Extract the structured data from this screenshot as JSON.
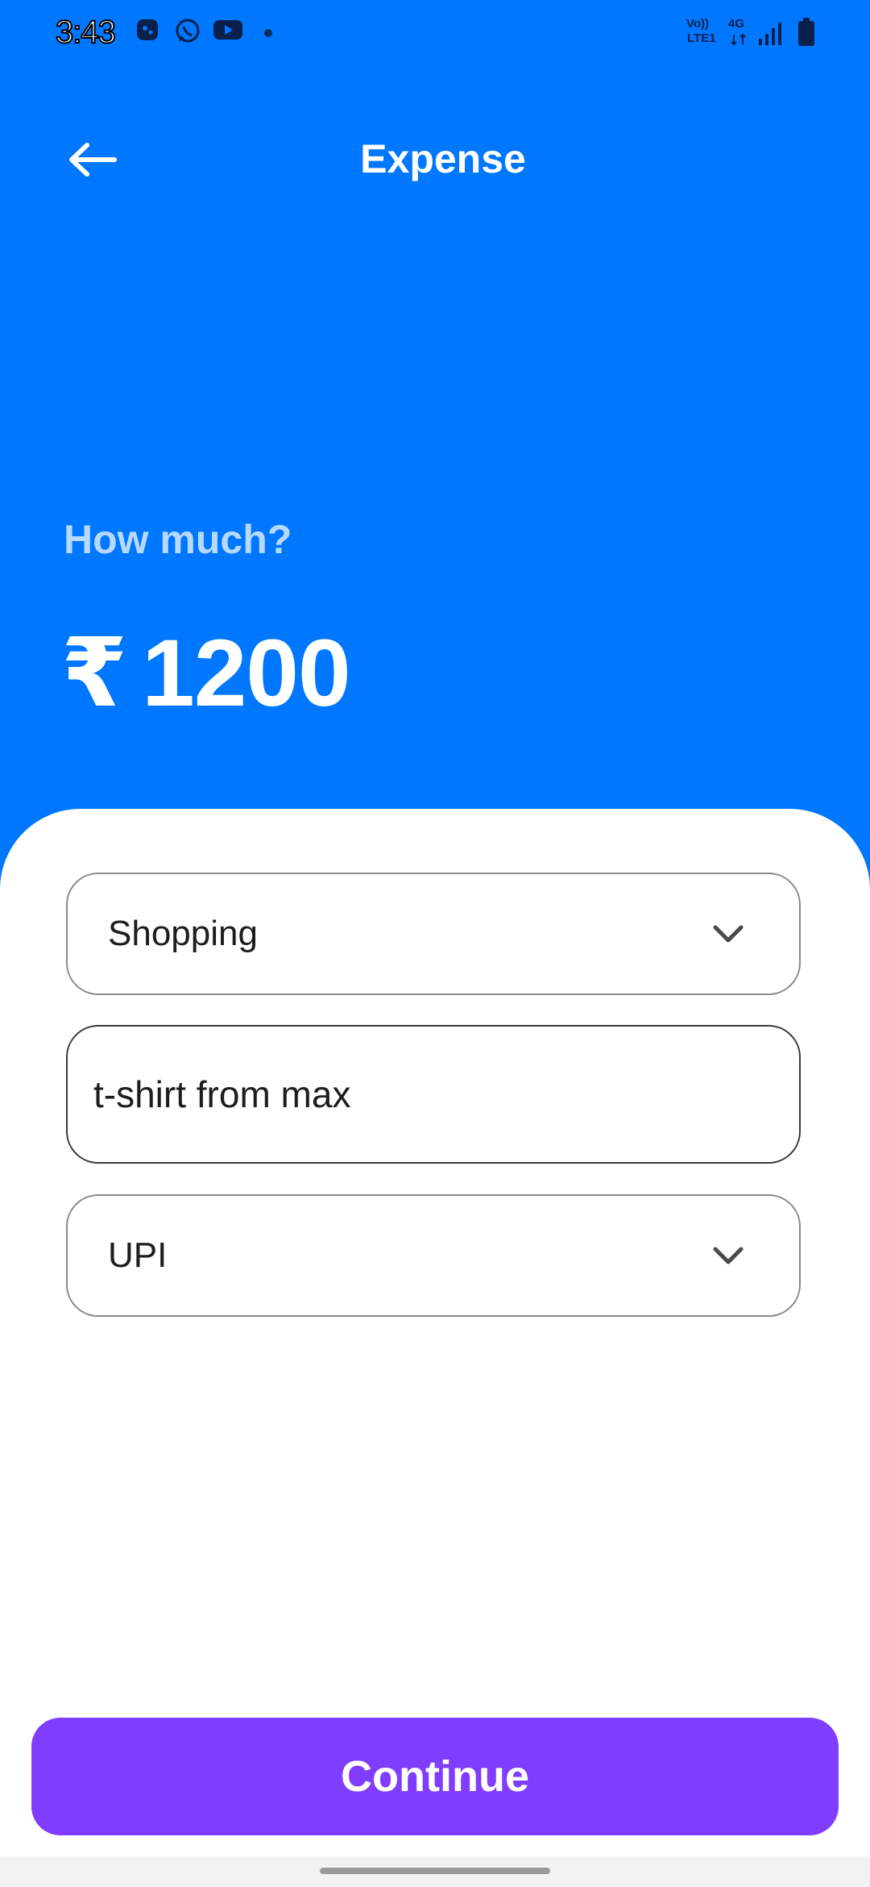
{
  "status_bar": {
    "time": "3:43",
    "network_volte": "Vo))",
    "network_lte": "LTE1",
    "network_4g": "4G",
    "icons": [
      "game-icon",
      "whatsapp-icon",
      "youtube-icon",
      "notification-dot",
      "signal-icon",
      "battery-icon"
    ]
  },
  "header": {
    "back_icon": "arrow-left-icon",
    "title": "Expense"
  },
  "amount_section": {
    "prompt": "How much?",
    "currency_symbol": "₹",
    "amount": "1200"
  },
  "form": {
    "category": {
      "selected": "Shopping",
      "icon": "chevron-down-icon"
    },
    "description": {
      "value": "t-shirt from max"
    },
    "payment_method": {
      "selected": "UPI",
      "icon": "chevron-down-icon"
    }
  },
  "actions": {
    "continue_label": "Continue"
  },
  "colors": {
    "header_bg": "#0077FF",
    "button_bg": "#7F3DFF",
    "sheet_bg": "#FFFFFF"
  }
}
